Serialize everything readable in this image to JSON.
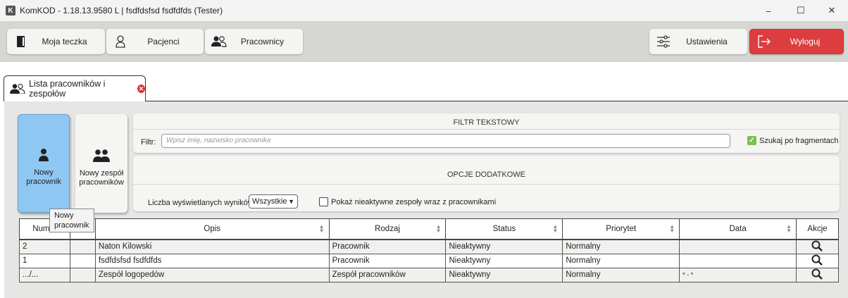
{
  "window": {
    "app_icon": "K",
    "title": "KomKOD - 1.18.13.9580 L | fsdfdsfsd fsdfdfds (Tester)",
    "minimize": "–",
    "maximize": "☐",
    "close": "✕"
  },
  "toolbar": {
    "moja_teczka": "Moja teczka",
    "pacjenci": "Pacjenci",
    "pracownicy": "Pracownicy",
    "ustawienia": "Ustawienia",
    "wyloguj": "Wyloguj"
  },
  "tab": {
    "label": "Lista pracowników i zespołów"
  },
  "actions": {
    "nowy_pracownik": "Nowy pracownik",
    "nowy_zespol": "Nowy zespół pracowników"
  },
  "filter": {
    "section_title": "FILTR TEKSTOWY",
    "label": "Filtr:",
    "placeholder": "Wpisz imię, nazwisko pracownika",
    "fragments_label": "Szukaj po fragmentach",
    "fragments_checked": true
  },
  "options": {
    "section_title": "OPCJE DODATKOWE",
    "results_label": "Liczba wyświetlanych wyników:",
    "results_value": "Wszystkie",
    "inactive_label": "Pokaż nieaktywne zespoły wraz z pracownikami",
    "inactive_checked": false
  },
  "tooltip": "Nowy pracownik",
  "table": {
    "columns": [
      "Numer",
      "",
      "Opis",
      "Rodzaj",
      "Status",
      "Priorytet",
      "Data",
      "Akcje"
    ],
    "rows": [
      [
        "2",
        "",
        "Naton Kilowski",
        "Pracownik",
        "Nieaktywny",
        "Normalny",
        ""
      ],
      [
        "1",
        "",
        "fsdfdsfsd fsdfdfds",
        "Pracownik",
        "Nieaktywny",
        "Normalny",
        ""
      ],
      [
        ".../...",
        "",
        "Zespół logopedów",
        "Zespół pracowników",
        "Nieaktywny",
        "Normalny",
        "* - *"
      ]
    ]
  },
  "colors": {
    "active_button": "#8fc7f3",
    "logout": "#dc3d3e",
    "checkbox": "#7bc04c"
  }
}
